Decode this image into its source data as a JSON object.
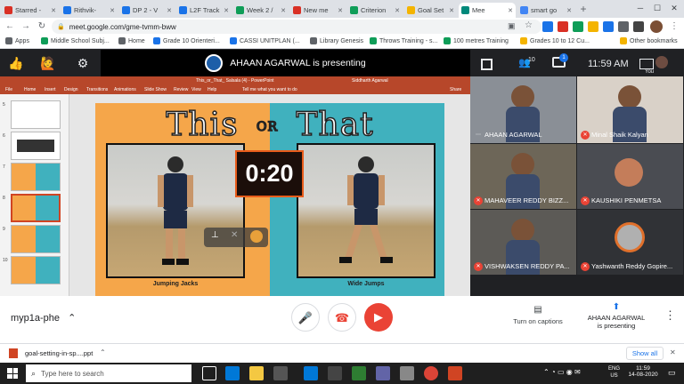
{
  "browser": {
    "tabs": [
      {
        "label": "Starred -",
        "color": "#d93025"
      },
      {
        "label": "Rithvik-",
        "color": "#1a73e8"
      },
      {
        "label": "DP 2 - V",
        "color": "#1a73e8"
      },
      {
        "label": "L2F Track",
        "color": "#1a73e8"
      },
      {
        "label": "Week 2 /",
        "color": "#0f9d58"
      },
      {
        "label": "New me",
        "color": "#d93025"
      },
      {
        "label": "Criterion",
        "color": "#0f9d58"
      },
      {
        "label": "Goal Set",
        "color": "#f4b400"
      },
      {
        "label": "Mee",
        "color": "#00897b"
      },
      {
        "label": "smart go",
        "color": "#4285f4"
      }
    ],
    "url": "meet.google.com/gme-tvmm-bww",
    "bookmarks": [
      {
        "label": "Apps",
        "color": "#5f6368"
      },
      {
        "label": "Middle School Subj...",
        "color": "#0f9d58"
      },
      {
        "label": "Home",
        "color": "#5f6368"
      },
      {
        "label": "Grade 10 Orienteri...",
        "color": "#1a73e8"
      },
      {
        "label": "CASSI UNITPLAN (...",
        "color": "#1a73e8"
      },
      {
        "label": "Library Genesis",
        "color": "#5f6368"
      },
      {
        "label": "Throws Training - s...",
        "color": "#0f9d58"
      },
      {
        "label": "100 metres Training",
        "color": "#0f9d58"
      },
      {
        "label": "Grades 10 to 12 Cu...",
        "color": "#f4b400"
      },
      {
        "label": "Other bookmarks",
        "color": "#f4b400"
      }
    ]
  },
  "meet": {
    "presenting_banner": "AHAAN AGARWAL is presenting",
    "participant_count": "10",
    "chat_count": "1",
    "time": "11:59 AM",
    "you_label": "You",
    "meeting_code": "myp1a-phe",
    "captions_label": "Turn on captions",
    "presenting_label": "AHAAN AGARWAL\nis presenting",
    "participants": [
      {
        "name": "AHAAN AGARWAL",
        "muted": false
      },
      {
        "name": "Minal Shaik Kalyan",
        "muted": true
      },
      {
        "name": "MAHAVEER REDDY BIZZ...",
        "muted": true
      },
      {
        "name": "KAUSHIKI PENMETSA",
        "muted": true
      },
      {
        "name": "VISHWAKSEN REDDY PA...",
        "muted": true
      },
      {
        "name": "Yashwanth Reddy Gopire...",
        "muted": true
      }
    ]
  },
  "powerpoint": {
    "title": "This_or_That_ Salsala (4) - PowerPoint",
    "user": "Siddharth Agarwal",
    "ribbon": [
      "File",
      "Home",
      "Insert",
      "Design",
      "Transitions",
      "Animations",
      "Slide Show",
      "Review",
      "View",
      "Help",
      "Tell me what you want to do",
      "Share"
    ],
    "slide_numbers": [
      "5",
      "6",
      "7",
      "8",
      "9",
      "10"
    ],
    "slide": {
      "title_left": "This",
      "title_or": "OR",
      "title_right": "That",
      "timer": "0:20",
      "left_caption": "Jumping Jacks",
      "right_caption": "Wide Jumps"
    }
  },
  "download": {
    "file": "goal-setting-in-sp....ppt",
    "show_all": "Show all"
  },
  "taskbar": {
    "search": "Type here to search",
    "lang": "ENG\nUS",
    "time": "11:59",
    "date": "14-08-2020"
  }
}
